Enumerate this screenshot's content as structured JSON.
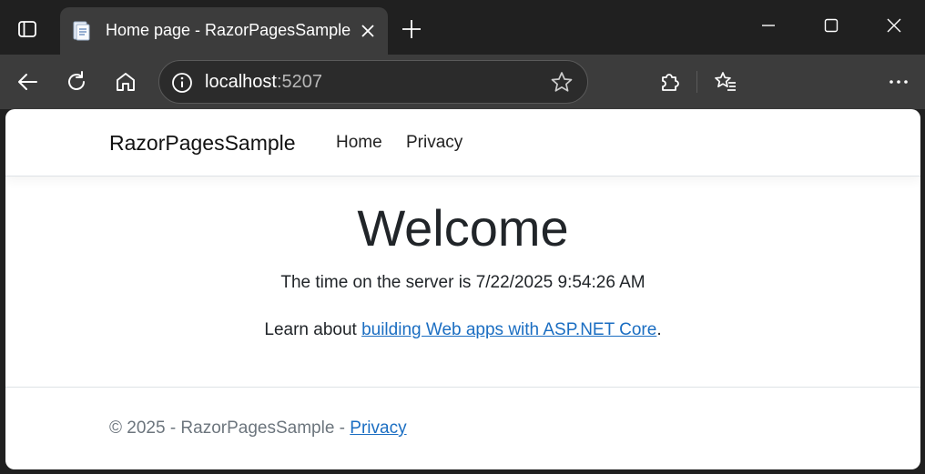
{
  "browser": {
    "tab": {
      "title": "Home page - RazorPagesSample",
      "favicon": "page-icon"
    },
    "address": {
      "host": "localhost",
      "port": ":5207"
    },
    "icons": {
      "tab_actions": "tab-actions-icon",
      "close_tab": "close-icon",
      "new_tab": "plus-icon",
      "minimize": "minimize-icon",
      "maximize": "maximize-icon",
      "close_window": "close-icon",
      "back": "back-arrow-icon",
      "refresh": "refresh-icon",
      "home": "home-icon",
      "site_info": "info-icon",
      "favorite": "star-icon",
      "extensions": "puzzle-icon",
      "favorites": "favorites-list-icon",
      "more": "more-icon"
    }
  },
  "site": {
    "brand": "RazorPagesSample",
    "nav": {
      "home": "Home",
      "privacy": "Privacy"
    },
    "main": {
      "heading": "Welcome",
      "server_time": "The time on the server is 7/22/2025 9:54:26 AM",
      "learn_prefix": "Learn about ",
      "learn_link": "building Web apps with ASP.NET Core",
      "learn_suffix": "."
    },
    "footer": {
      "text": "© 2025 - RazorPagesSample - ",
      "privacy_link": "Privacy"
    }
  },
  "colors": {
    "link": "#1b6ec2",
    "chrome_dark": "#202020",
    "chrome_tab": "#3c3c3c"
  }
}
